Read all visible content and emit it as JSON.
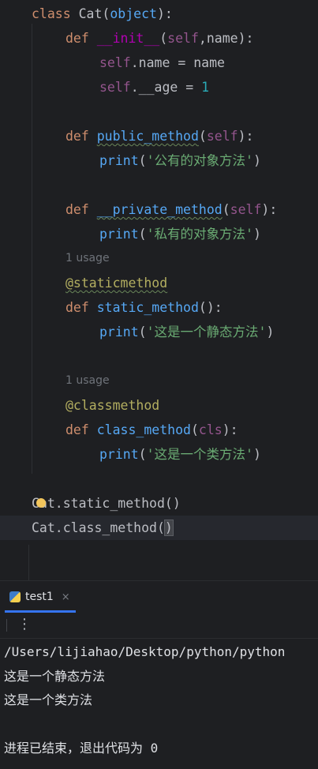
{
  "editor": {
    "lines": {
      "l1": {
        "kw": "class",
        "name": "Cat",
        "open": "(",
        "base": "object",
        "close": "):"
      },
      "l2": {
        "kw": "def",
        "name": "__init__",
        "open": "(",
        "self": "self",
        "sep": ",",
        "param": "name",
        "close": "):"
      },
      "l3": {
        "self": "self",
        "rest": ".name = name"
      },
      "l4": {
        "self": "self",
        "rest": ".__age = ",
        "num": "1"
      },
      "l5": {
        "kw": "def",
        "name": "public_method",
        "open": "(",
        "self": "self",
        "close": "):"
      },
      "l6": {
        "fn": "print",
        "open": "(",
        "str": "'公有的对象方法'",
        "close": ")"
      },
      "l7": {
        "kw": "def",
        "name": "__private_method",
        "open": "(",
        "self": "self",
        "close": "):"
      },
      "l8": {
        "fn": "print",
        "open": "(",
        "str": "'私有的对象方法'",
        "close": ")"
      },
      "usage1": "1 usage",
      "l9": {
        "dec": "@staticmethod"
      },
      "l10": {
        "kw": "def",
        "name": "static_method",
        "rest": "():"
      },
      "l11": {
        "fn": "print",
        "open": "(",
        "str": "'这是一个静态方法'",
        "close": ")"
      },
      "usage2": "1 usage",
      "l12": {
        "dec": "@classmethod"
      },
      "l13": {
        "kw": "def",
        "name": "class_method",
        "open": "(",
        "param": "cls",
        "close": "):"
      },
      "l14": {
        "fn": "print",
        "open": "(",
        "str": "'这是一个类方法'",
        "close": ")"
      },
      "l15": {
        "a": "C",
        "b": "at.static_method()"
      },
      "l16": {
        "a": "Cat.class_method(",
        "b": ")"
      }
    }
  },
  "run_panel": {
    "tab_label": "test1",
    "close_icon": "×",
    "more_icon": "⋮",
    "console": {
      "path": "/Users/lijiahao/Desktop/python/python",
      "out1": "这是一个静态方法",
      "out2": "这是一个类方法",
      "exit": "进程已结束，退出代码为 0"
    }
  },
  "colors": {
    "keyword": "#cf8e6d",
    "function": "#56a8f5",
    "string": "#6aab73",
    "magic": "#b200b2",
    "self": "#94558d",
    "number": "#2aacb8",
    "decorator": "#b3ae60",
    "accent": "#3574f0"
  }
}
